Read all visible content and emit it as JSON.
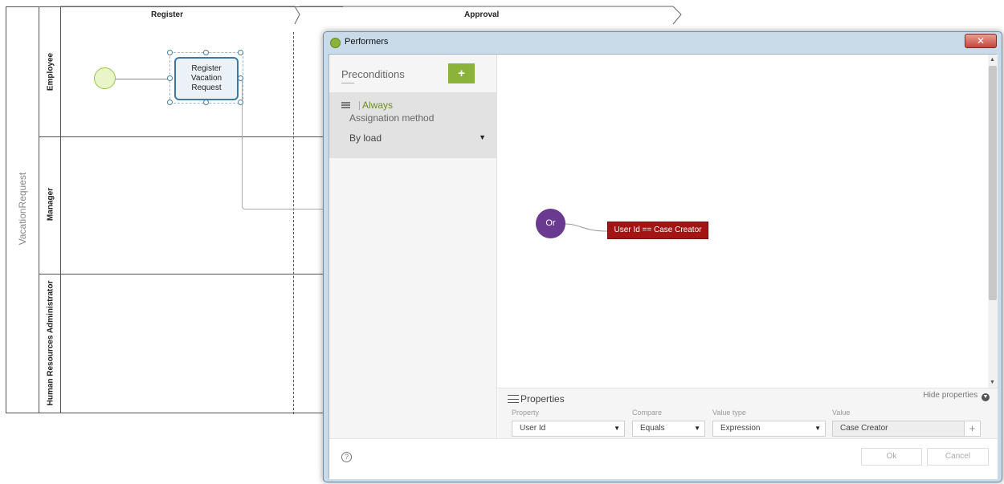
{
  "diagram": {
    "pool_name": "VacationRequest",
    "lanes": [
      "Employee",
      "Manager",
      "Human Resources Administrator"
    ],
    "stages": [
      "Register",
      "Approval"
    ],
    "task_label": "Register Vacation Request"
  },
  "dialog": {
    "title": "Performers",
    "close_glyph": "✕",
    "preconditions": {
      "title": "Preconditions",
      "add_label": "+",
      "item": {
        "name": "Always",
        "assignation_label": "Assignation method",
        "assignation_value": "By load"
      }
    },
    "canvas": {
      "or_node_label": "Or",
      "rule_label": "User Id == Case Creator"
    },
    "properties": {
      "title": "Properties",
      "hide_label": "Hide properties",
      "columns": {
        "property": "Property",
        "compare": "Compare",
        "value_type": "Value type",
        "value": "Value"
      },
      "row": {
        "property": "User Id",
        "compare": "Equals",
        "value_type": "Expression",
        "value": "Case Creator"
      },
      "add_value_glyph": "+"
    },
    "footer": {
      "help_glyph": "?",
      "ok_label": "Ok",
      "cancel_label": "Cancel"
    }
  },
  "colors": {
    "accent_green": "#8bb33a",
    "or_node": "#693a8f",
    "rule_node": "#a31515",
    "task_border": "#3d7aa3"
  }
}
